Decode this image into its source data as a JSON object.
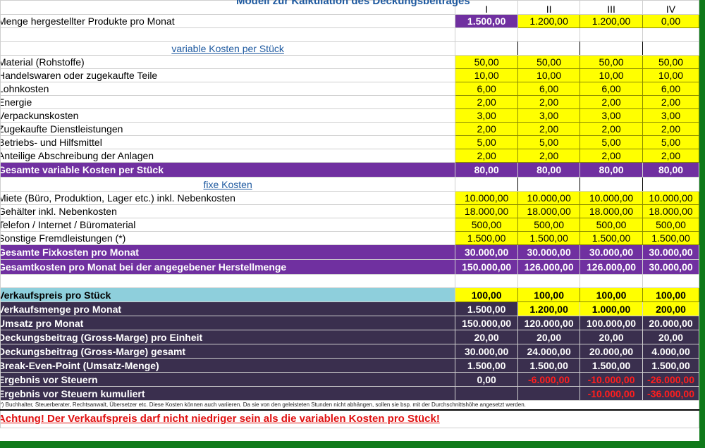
{
  "title": "Modell zur Kalkulation des Deckungsbeitrages",
  "columns": [
    "I",
    "II",
    "III",
    "IV"
  ],
  "menge": {
    "label": "Menge hergestellter Produkte pro Monat",
    "values": [
      "1.500,00",
      "1.200,00",
      "1.200,00",
      "0,00"
    ]
  },
  "variable": {
    "section": "variable Kosten per Stück",
    "rows": [
      {
        "label": "Material (Rohstoffe)",
        "values": [
          "50,00",
          "50,00",
          "50,00",
          "50,00"
        ]
      },
      {
        "label": "Handelswaren oder zugekaufte Teile",
        "values": [
          "10,00",
          "10,00",
          "10,00",
          "10,00"
        ]
      },
      {
        "label": "Lohnkosten",
        "values": [
          "6,00",
          "6,00",
          "6,00",
          "6,00"
        ]
      },
      {
        "label": "Energie",
        "values": [
          "2,00",
          "2,00",
          "2,00",
          "2,00"
        ]
      },
      {
        "label": "Verpackunskosten",
        "values": [
          "3,00",
          "3,00",
          "3,00",
          "3,00"
        ]
      },
      {
        "label": "Zugekaufte Dienstleistungen",
        "values": [
          "2,00",
          "2,00",
          "2,00",
          "2,00"
        ]
      },
      {
        "label": "Betriebs- und Hilfsmittel",
        "values": [
          "5,00",
          "5,00",
          "5,00",
          "5,00"
        ]
      },
      {
        "label": "Anteilige Abschreibung der Anlagen",
        "values": [
          "2,00",
          "2,00",
          "2,00",
          "2,00"
        ]
      }
    ],
    "total": {
      "label": "Gesamte variable Kosten per Stück",
      "values": [
        "80,00",
        "80,00",
        "80,00",
        "80,00"
      ]
    }
  },
  "fixe": {
    "section": "fixe Kosten",
    "rows": [
      {
        "label": "Miete (Büro, Produktion, Lager etc.) inkl. Nebenkosten",
        "values": [
          "10.000,00",
          "10.000,00",
          "10.000,00",
          "10.000,00"
        ]
      },
      {
        "label": "Gehälter inkl. Nebenkosten",
        "values": [
          "18.000,00",
          "18.000,00",
          "18.000,00",
          "18.000,00"
        ]
      },
      {
        "label": "Telefon / Internet / Büromaterial",
        "values": [
          "500,00",
          "500,00",
          "500,00",
          "500,00"
        ]
      },
      {
        "label": "Sonstige Fremdleistungen (*)",
        "values": [
          "1.500,00",
          "1.500,00",
          "1.500,00",
          "1.500,00"
        ]
      }
    ],
    "total": {
      "label": "Gesamte Fixkosten pro Monat",
      "values": [
        "30.000,00",
        "30.000,00",
        "30.000,00",
        "30.000,00"
      ]
    },
    "gesamt": {
      "label": "Gesamtkosten pro Monat bei der angegebener Herstellmenge",
      "values": [
        "150.000,00",
        "126.000,00",
        "126.000,00",
        "30.000,00"
      ]
    }
  },
  "verkauf": {
    "preis": {
      "label": "Verkaufspreis pro Stück",
      "values": [
        "100,00",
        "100,00",
        "100,00",
        "100,00"
      ]
    },
    "rows": [
      {
        "label": "Verkaufsmenge pro Monat",
        "values": [
          "1.500,00",
          "1.200,00",
          "1.000,00",
          "200,00"
        ]
      },
      {
        "label": "Umsatz pro Monat",
        "values": [
          "150.000,00",
          "120.000,00",
          "100.000,00",
          "20.000,00"
        ]
      },
      {
        "label": "Deckungsbeitrag (Gross-Marge) pro Einheit",
        "values": [
          "20,00",
          "20,00",
          "20,00",
          "20,00"
        ]
      },
      {
        "label": "Deckungsbeitrag (Gross-Marge) gesamt",
        "values": [
          "30.000,00",
          "24.000,00",
          "20.000,00",
          "4.000,00"
        ]
      },
      {
        "label": "Break-Even-Point (Umsatz-Menge)",
        "values": [
          "1.500,00",
          "1.500,00",
          "1.500,00",
          "1.500,00"
        ]
      },
      {
        "label": "Ergebnis vor Steuern",
        "values": [
          "0,00",
          "-6.000,00",
          "-10.000,00",
          "-26.000,00"
        ]
      },
      {
        "label": "Ergebnis vor Steuern kumuliert",
        "values": [
          "",
          "",
          "-10.000,00",
          "-36.000,00"
        ]
      }
    ]
  },
  "footnote": "(*) Buchhalter, Steuerberater, Rechtsanwalt, Übersetzer etc. Diese Kosten können auch variieren. Da sie von den geleisteten Stunden nicht abhängen, sollen sie bsp. mit der Durchschnittshöhe angesetzt werden.",
  "warning": "Achtung! Der Verkaufspreis darf nicht niedriger sein als die variablen Kosten pro Stück!",
  "colors": {
    "frame": "#0f7a1a",
    "purple": "#7030a0",
    "dark": "#3a2f4e",
    "yellow": "#ffff00",
    "lightblue": "#8ecfdc",
    "red": "#ff1e1e"
  }
}
